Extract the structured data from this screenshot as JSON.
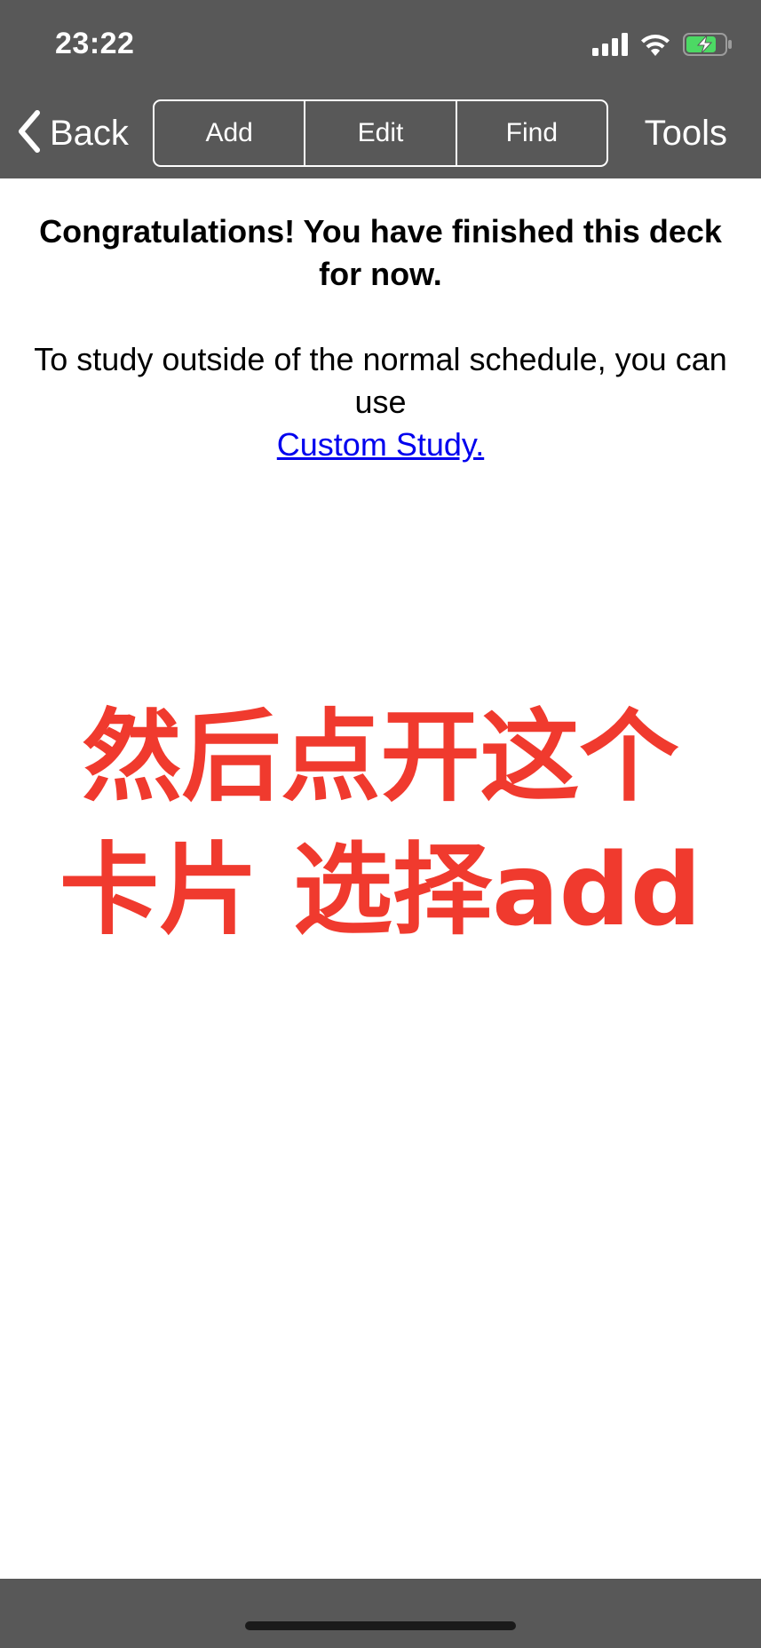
{
  "status_bar": {
    "time": "23:22",
    "icons": [
      "signal-icon",
      "wifi-icon",
      "battery-charging-icon"
    ]
  },
  "nav": {
    "back_label": "Back",
    "segments": [
      "Add",
      "Edit",
      "Find"
    ],
    "tools_label": "Tools"
  },
  "content": {
    "congrats": "Congratulations! You have finished this deck for now.",
    "info": "To study outside of the normal schedule, you can use",
    "link": "Custom Study."
  },
  "overlay": {
    "line1": "然后点开这个",
    "line2": "卡片 选择add"
  },
  "colors": {
    "bar_background": "#585858",
    "link": "#0000ee",
    "overlay_text": "#f03a2e",
    "battery_fill": "#4cd964"
  }
}
